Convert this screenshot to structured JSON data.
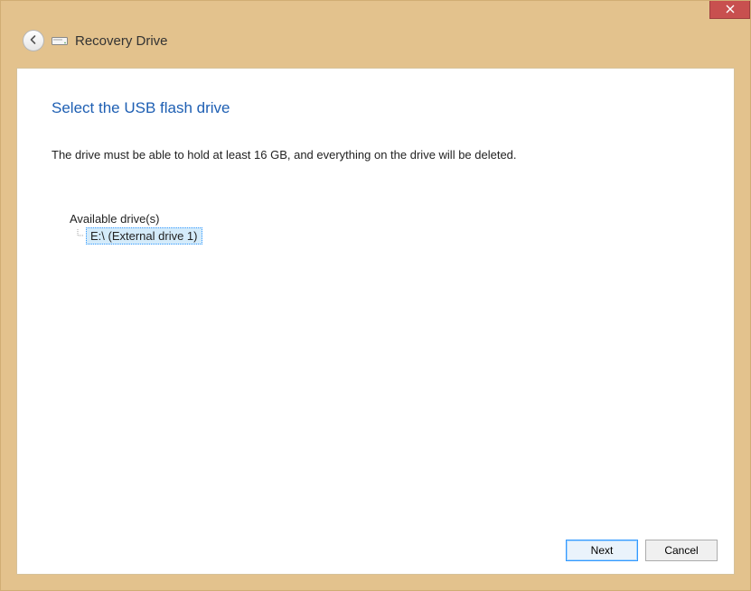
{
  "titlebar": {
    "close_label": "Close"
  },
  "header": {
    "title": "Recovery Drive"
  },
  "main": {
    "heading": "Select the USB flash drive",
    "description": "The drive must be able to hold at least 16 GB, and everything on the drive will be deleted.",
    "drives_label": "Available drive(s)",
    "drives": [
      {
        "label": "E:\\ (External drive 1)",
        "selected": true
      }
    ]
  },
  "footer": {
    "next_label": "Next",
    "cancel_label": "Cancel"
  }
}
